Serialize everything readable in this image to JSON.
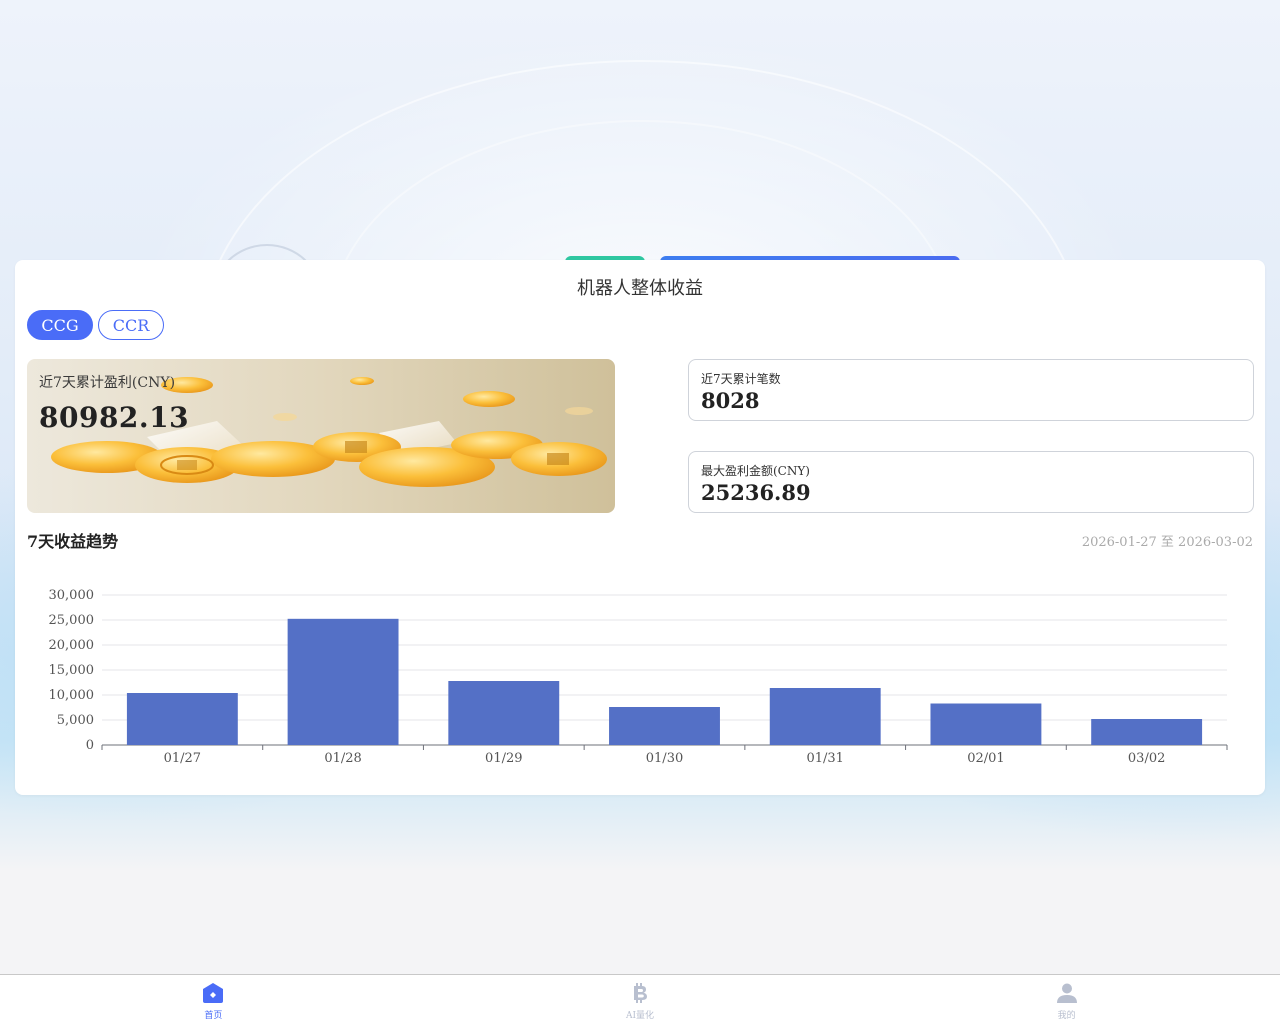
{
  "card": {
    "title": "机器人整体收益"
  },
  "tabs": [
    {
      "label": "CCG",
      "active": true
    },
    {
      "label": "CCR",
      "active": false
    }
  ],
  "profit_banner": {
    "label": "近7天累计盈利(CNY)",
    "value": "80982.13"
  },
  "stats": {
    "trades": {
      "label": "近7天累计笔数",
      "value": "8028"
    },
    "max_profit": {
      "label": "最大盈利金额(CNY)",
      "value": "25236.89"
    }
  },
  "trend": {
    "title": "7天收益趋势",
    "range": "2026-01-27 至 2026-03-02"
  },
  "chart_data": {
    "type": "bar",
    "categories": [
      "01/27",
      "01/28",
      "01/29",
      "01/30",
      "01/31",
      "02/01",
      "03/02"
    ],
    "values": [
      10400,
      25236.89,
      12800,
      7600,
      11400,
      8300,
      5200
    ],
    "ylim": [
      0,
      30000
    ],
    "yticks": [
      0,
      5000,
      10000,
      15000,
      20000,
      25000,
      30000
    ],
    "ytick_labels": [
      "0",
      "5,000",
      "10,000",
      "15,000",
      "20,000",
      "25,000",
      "30,000"
    ],
    "bar_color": "#5470c6",
    "grid": true
  },
  "nav": {
    "items": [
      {
        "label": "首页",
        "icon": "home-icon",
        "active": true
      },
      {
        "label": "AI量化",
        "icon": "bitcoin-icon",
        "active": false
      },
      {
        "label": "我的",
        "icon": "user-icon",
        "active": false
      }
    ]
  },
  "colors": {
    "accent": "#4a6cf7",
    "inactive": "#b8bfcf"
  }
}
